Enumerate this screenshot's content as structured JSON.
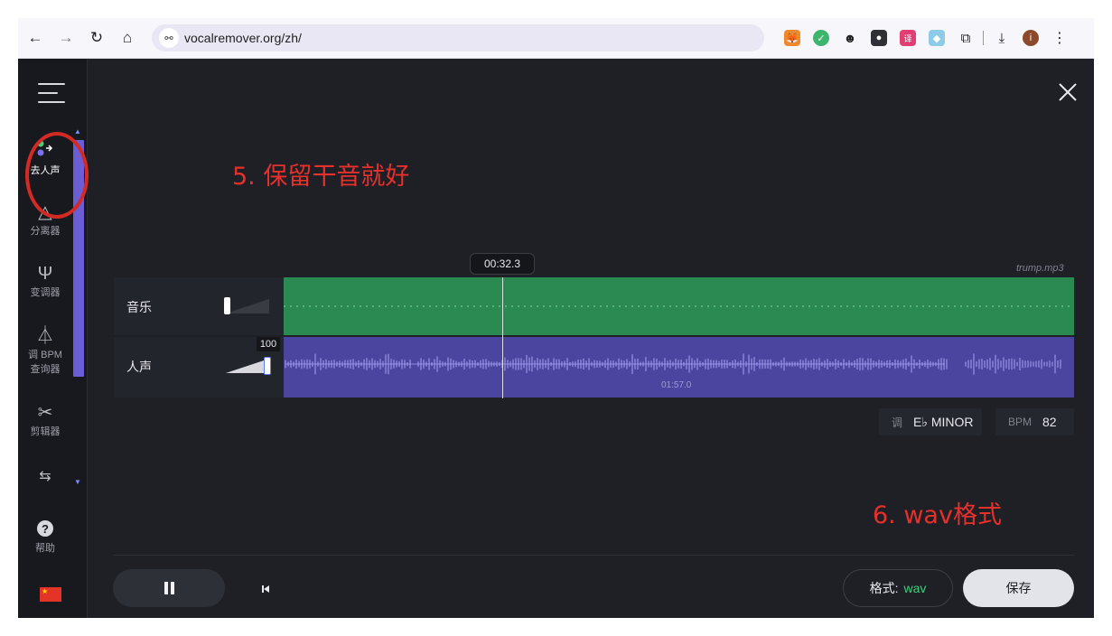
{
  "browser": {
    "url": "vocalremover.org/zh/",
    "site_info_icon": "tune-icon",
    "extensions": [
      "metamask-icon",
      "shield-icon",
      "face-icon",
      "incognito-icon",
      "translate-icon",
      "cube-icon",
      "puzzle-icon"
    ]
  },
  "sidebar": {
    "items": [
      {
        "label": "去人声",
        "icon": "vocal-remover-icon"
      },
      {
        "label": "分离器",
        "icon": "prism-icon"
      },
      {
        "label": "变调器",
        "icon": "tuning-fork-icon"
      },
      {
        "label": "调 BPM 查询器",
        "label_line1": "调 BPM",
        "label_line2": "查询器",
        "icon": "metronome-icon"
      },
      {
        "label": "剪辑器",
        "icon": "scissors-icon"
      },
      {
        "label": "",
        "icon": "joiner-icon"
      },
      {
        "label": "帮助",
        "icon": "help-icon"
      }
    ],
    "language_flag": "china-flag-icon"
  },
  "annotations": {
    "step5": "5. 保留干音就好",
    "step6": "6.  wav格式",
    "color": "#e5302c"
  },
  "player": {
    "current_time": "00:32.3",
    "filename": "trump.mp3",
    "tracks": [
      {
        "name": "音乐",
        "volume": 0
      },
      {
        "name": "人声",
        "volume": 100,
        "volume_label": "100"
      }
    ],
    "vocal_track_time": "01:57.0",
    "key_label": "调",
    "key_value": "E♭ MINOR",
    "bpm_label": "BPM",
    "bpm_value": "82",
    "format_label": "格式:",
    "format_value": "wav",
    "save_label": "保存",
    "colors": {
      "music_track": "#2b8a52",
      "vocal_track": "#4b45a0",
      "accent_green": "#3fd07b",
      "sidebar_scroll": "#6b5ed4"
    }
  }
}
